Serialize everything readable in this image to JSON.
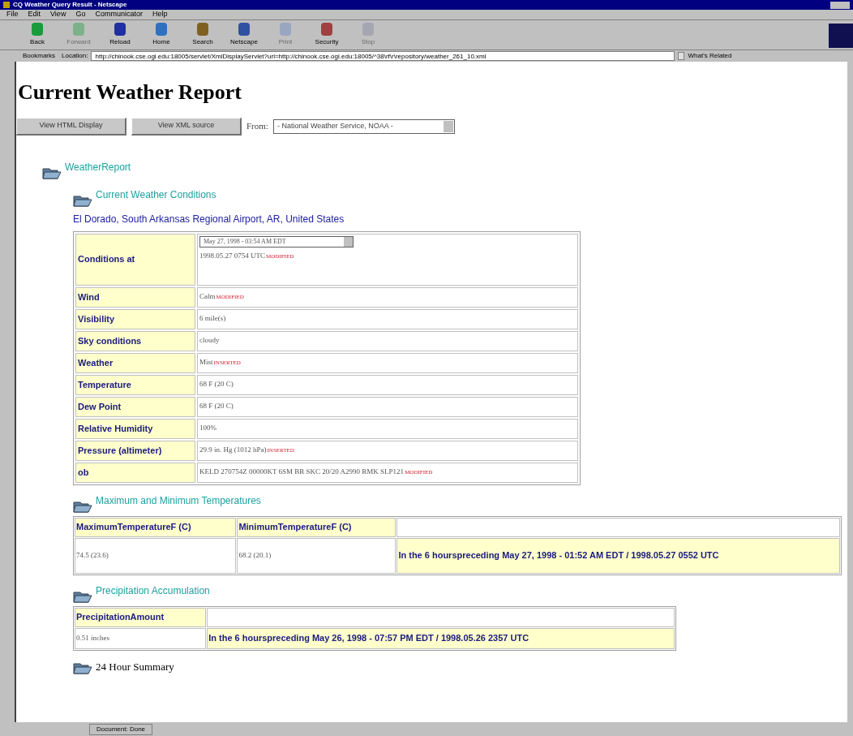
{
  "window": {
    "title": "CQ Weather Query Result - Netscape"
  },
  "menu": [
    "File",
    "Edit",
    "View",
    "Go",
    "Communicator",
    "Help"
  ],
  "toolbar": [
    {
      "label": "Back",
      "disabled": false
    },
    {
      "label": "Forward",
      "disabled": true
    },
    {
      "label": "Reload",
      "disabled": false
    },
    {
      "label": "Home",
      "disabled": false
    },
    {
      "label": "Search",
      "disabled": false
    },
    {
      "label": "Netscape",
      "disabled": false
    },
    {
      "label": "Print",
      "disabled": true
    },
    {
      "label": "Security",
      "disabled": false
    },
    {
      "label": "Stop",
      "disabled": true
    }
  ],
  "location_bar": {
    "bookmarks": "Bookmarks",
    "location_label": "Location:",
    "url": "http://chinook.cse.ogi.edu:18005/servlet/XmlDisplayServlet?url=http://chinook.cse.ogi.edu:18005/^38\\rf\\r\\repository/weather_261_10.xml",
    "related": "What's Related"
  },
  "page": {
    "heading": "Current Weather Report",
    "buttons": [
      "View HTML Display",
      "View XML source"
    ],
    "source_label": "From:",
    "source_value": "- National Weather Service, NOAA -"
  },
  "tree": {
    "label": "WeatherReport",
    "sections": [
      {
        "title": "Current Weather Conditions",
        "kind": "conditions",
        "station": "El Dorado, South Arkansas Regional Airport, AR, United States",
        "date_select": "May 27, 1998 - 03:54 AM EDT",
        "rows": [
          {
            "label": "Conditions at",
            "value": "1998.05.27 0754 UTC",
            "flag": "MODIFIED"
          },
          {
            "label": "Wind",
            "value": "Calm",
            "flag": "MODIFIED"
          },
          {
            "label": "Visibility",
            "value": "6 mile(s)"
          },
          {
            "label": "Sky conditions",
            "value": "cloudy"
          },
          {
            "label": "Weather",
            "value": "Mist",
            "flag": "INSERTED"
          },
          {
            "label": "Temperature",
            "value": "68 F (20 C)"
          },
          {
            "label": "Dew Point",
            "value": "68 F (20 C)"
          },
          {
            "label": "Relative Humidity",
            "value": "100%"
          },
          {
            "label": "Pressure (altimeter)",
            "value": "29.9 in. Hg (1012 hPa)",
            "flag": "INSERTED"
          },
          {
            "label": "ob",
            "value": "KELD 270754Z 00000KT 6SM BR SKC 20/20 A2990 RMK SLP121",
            "flag": "MODIFIED"
          }
        ]
      },
      {
        "title": "Maximum and Minimum Temperatures",
        "kind": "table",
        "headers": [
          "MaximumTemperatureF (C)",
          "MinimumTemperatureF (C)"
        ],
        "values": [
          "74.5 (23.6)",
          "68.2 (20.1)"
        ],
        "period": "In the 6 hourspreceding May 27, 1998 - 01:52 AM EDT / 1998.05.27 0552 UTC"
      },
      {
        "title": "Precipitation Accumulation",
        "kind": "table",
        "headers": [
          "PrecipitationAmount"
        ],
        "values": [
          "0.51 inches"
        ],
        "period": "In the 6 hourspreceding May 26, 1998 - 07:57 PM EDT / 1998.05.26 2357 UTC"
      },
      {
        "title": "24 Hour Summary",
        "kind": "collapsed"
      }
    ]
  },
  "status_bar": {
    "text": "Document: Done"
  }
}
